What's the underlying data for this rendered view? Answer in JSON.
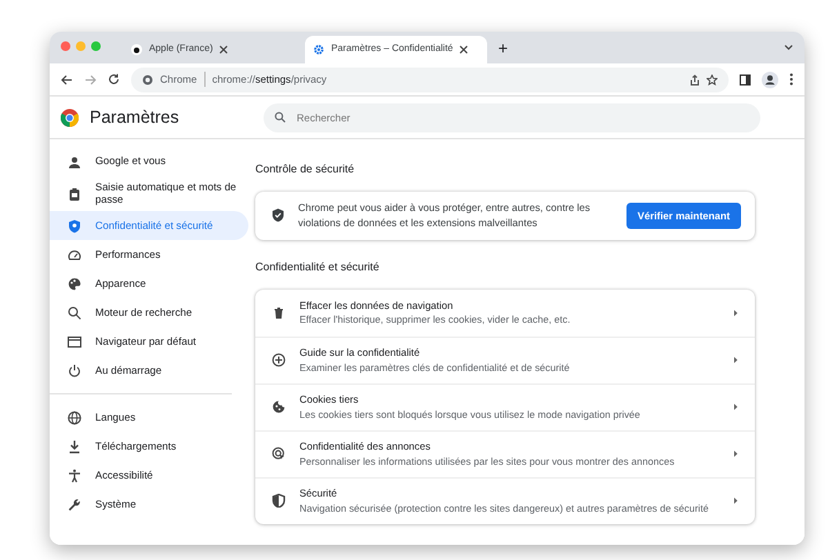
{
  "window": {
    "tabs": [
      {
        "title": "Apple (France)",
        "selected": false,
        "kind": "site"
      },
      {
        "title": "Paramètres – Confidentialité",
        "selected": true,
        "kind": "settings"
      }
    ],
    "new_tab": "+"
  },
  "toolbar": {
    "site_label": "Chrome",
    "url": "chrome://**settings**/privacy"
  },
  "header": {
    "title": "Paramètres",
    "search": {
      "placeholder": "Rechercher"
    }
  },
  "sidebar": {
    "groups": [
      {
        "items": [
          {
            "label": "Google et vous",
            "selected": false
          },
          {
            "label": "Saisie automatique et mots de passe",
            "selected": false
          },
          {
            "label": "Confidentialité et sécurité",
            "selected": true
          },
          {
            "label": "Performances",
            "selected": false
          },
          {
            "label": "Apparence",
            "selected": false
          },
          {
            "label": "Moteur de recherche",
            "selected": false
          },
          {
            "label": "Navigateur par défaut",
            "selected": false
          },
          {
            "label": "Au démarrage",
            "selected": false
          }
        ]
      },
      {
        "items": [
          {
            "label": "Langues",
            "selected": false
          },
          {
            "label": "Téléchargements",
            "selected": false
          },
          {
            "label": "Accessibilité",
            "selected": false
          },
          {
            "label": "Système",
            "selected": false
          }
        ]
      }
    ]
  },
  "safety_check": {
    "heading": "Contrôle de sécurité",
    "text": "Chrome peut vous aider à vous protéger, entre autres, contre les violations de données et les extensions malveillantes",
    "button": "Vérifier maintenant"
  },
  "privacy": {
    "heading": "Confidentialité et sécurité",
    "rows": [
      {
        "title": "Effacer les données de navigation",
        "description": "Effacer l'historique, supprimer les cookies, vider le cache, etc."
      },
      {
        "title": "Guide sur la confidentialité",
        "description": "Examiner les paramètres clés de confidentialité et de sécurité"
      },
      {
        "title": "Cookies tiers",
        "description": "Les cookies tiers sont bloqués lorsque vous utilisez le mode navigation privée"
      },
      {
        "title": "Confidentialité des annonces",
        "description": "Personnaliser les informations utilisées par les sites pour vous montrer des annonces"
      },
      {
        "title": "Sécurité",
        "description": "Navigation sécurisée (protection contre les sites dangereux) et autres paramètres de sécurité"
      }
    ]
  }
}
